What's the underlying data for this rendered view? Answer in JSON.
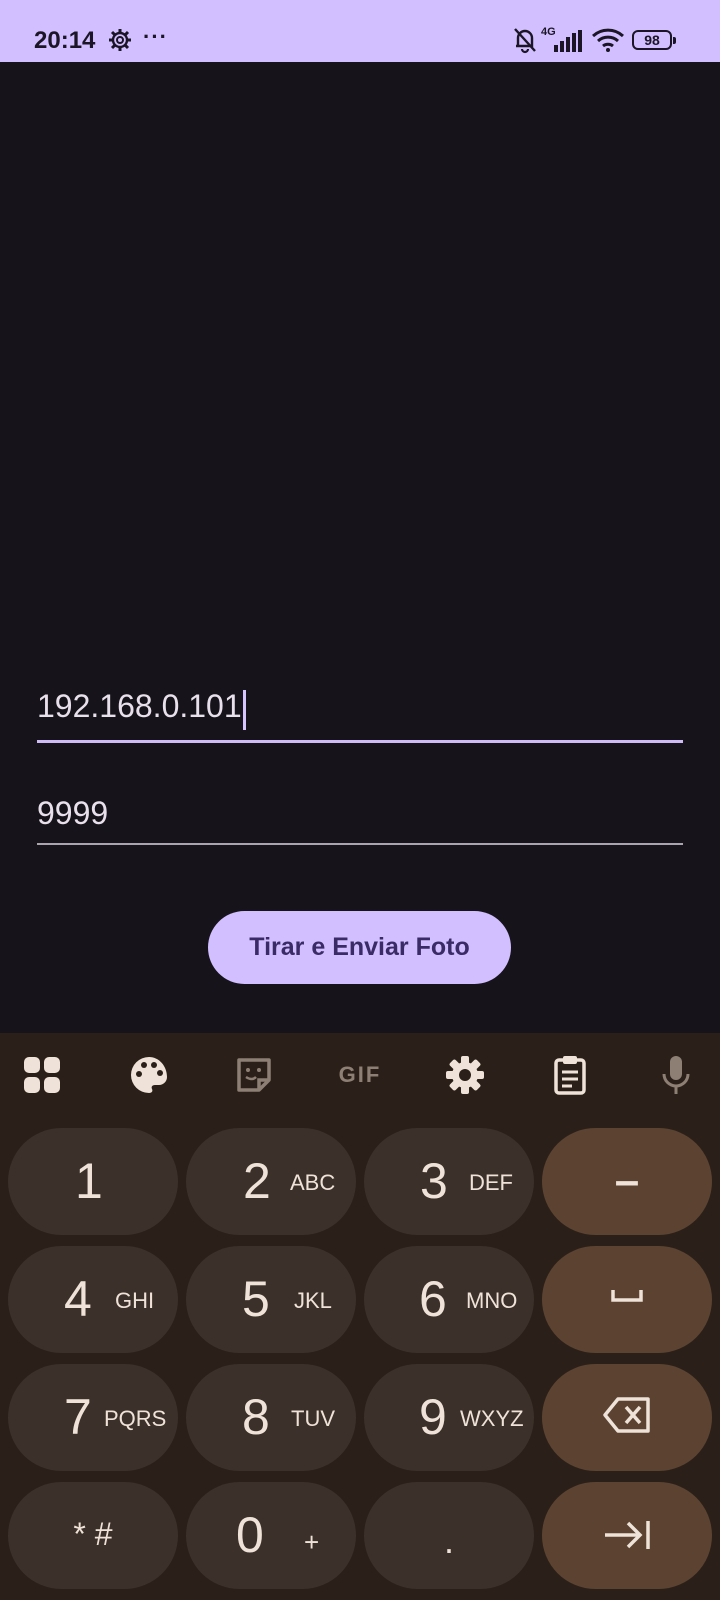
{
  "status_bar": {
    "time": "20:14",
    "network": "4G",
    "battery": "98",
    "icons": [
      "gear-icon",
      "more-dots-icon",
      "bell-off-icon",
      "signal-icon",
      "wifi-icon",
      "battery-icon"
    ]
  },
  "form": {
    "ip_value": "192.168.0.101",
    "port_value": "9999",
    "send_button_label": "Tirar e Enviar Foto"
  },
  "keyboard": {
    "toolbar_icons": [
      "apps-grid-icon",
      "palette-icon",
      "sticker-icon",
      "gif-icon",
      "settings-icon",
      "clipboard-icon",
      "mic-icon"
    ],
    "gif_label": "GIF",
    "keys": {
      "k1": {
        "digit": "1",
        "letters": ""
      },
      "k2": {
        "digit": "2",
        "letters": "ABC"
      },
      "k3": {
        "digit": "3",
        "letters": "DEF"
      },
      "k4": {
        "digit": "4",
        "letters": "GHI"
      },
      "k5": {
        "digit": "5",
        "letters": "JKL"
      },
      "k6": {
        "digit": "6",
        "letters": "MNO"
      },
      "k7": {
        "digit": "7",
        "letters": "PQRS"
      },
      "k8": {
        "digit": "8",
        "letters": "TUV"
      },
      "k9": {
        "digit": "9",
        "letters": "WXYZ"
      },
      "k0": {
        "digit": "0",
        "letters": "+"
      },
      "star": "* #",
      "dot": ".",
      "minus": "–"
    }
  },
  "colors": {
    "background": "#16131b",
    "accent": "#d2bfff",
    "key": "#3c302a",
    "action_key": "#5c4331",
    "keyboard_bg": "#2b2019"
  }
}
